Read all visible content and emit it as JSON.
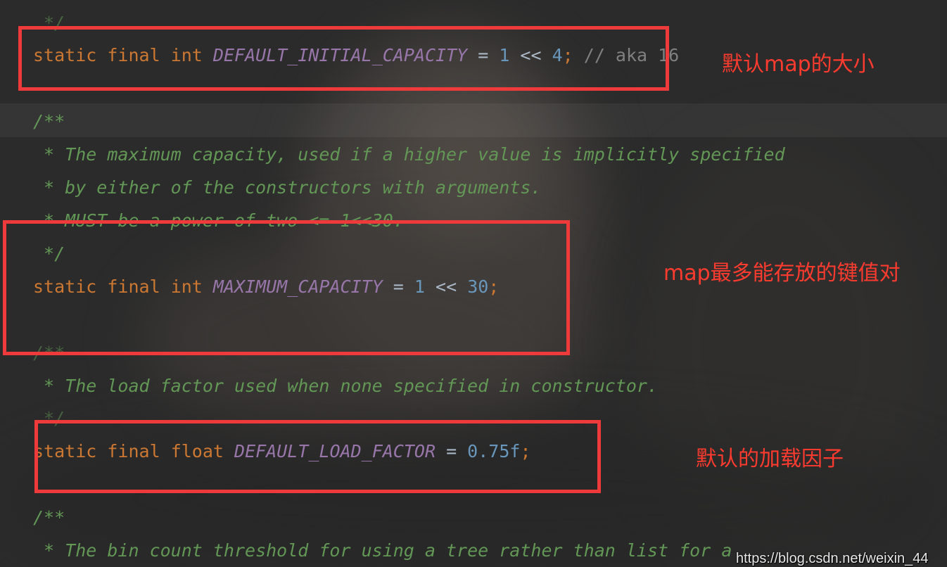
{
  "colors": {
    "background": "#2b2b2b",
    "keyword": "#cc7832",
    "constant": "#9876aa",
    "number": "#6897bb",
    "operator": "#a9b7c6",
    "comment": "#808080",
    "doc_comment": "#629755",
    "annotation": "#ff3b30"
  },
  "code": {
    "line_top_comment_close": "*/",
    "l1": {
      "kw1": "static",
      "kw2": "final",
      "kw3": "int",
      "name": "DEFAULT_INITIAL_CAPACITY",
      "eq": " = ",
      "a": "1",
      "shift": " << ",
      "b": "4",
      "semi": ";",
      "comment": " // aka 16"
    },
    "doc1_open": "/**",
    "doc1_line1": " * The maximum capacity, used if a higher value is implicitly specified",
    "doc1_line2": " * by either of the constructors with arguments.",
    "doc1_line3": " * MUST be a power of two <= 1<<30.",
    "doc1_close": " */",
    "l2": {
      "kw1": "static",
      "kw2": "final",
      "kw3": "int",
      "name": "MAXIMUM_CAPACITY",
      "eq": " = ",
      "a": "1",
      "shift": " << ",
      "b": "30",
      "semi": ";"
    },
    "doc2_open": "/**",
    "doc2_line1": " * The load factor used when none specified in constructor.",
    "doc2_close": " */",
    "l3": {
      "kw1": "static",
      "kw2": "final",
      "kw3": "float",
      "name": "DEFAULT_LOAD_FACTOR",
      "eq": " = ",
      "val": "0.75f",
      "semi": ";"
    },
    "doc3_open": "/**",
    "doc3_line1": " * The bin count threshold for using a tree rather than list for a"
  },
  "annotations": {
    "default_size": "默认map的大小",
    "max_entries": "map最多能存放的键值对",
    "default_load_factor": "默认的加载因子"
  },
  "watermark": "https://blog.csdn.net/weixin_44"
}
